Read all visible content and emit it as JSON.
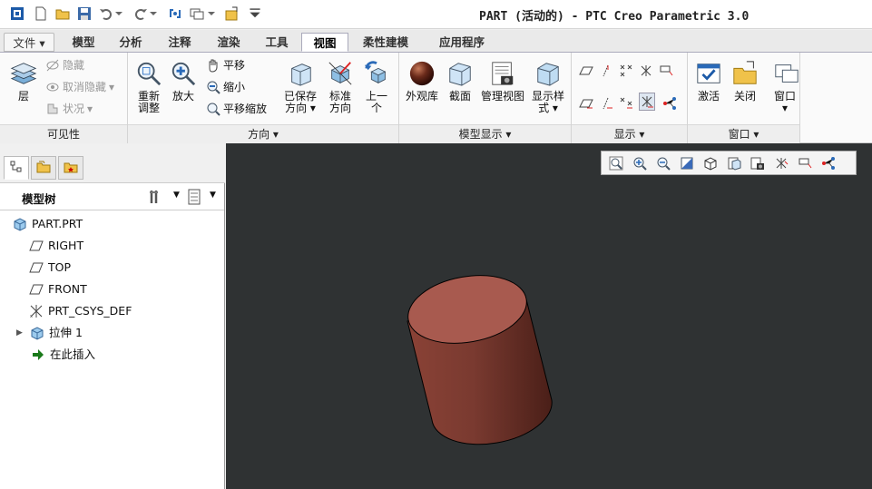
{
  "window": {
    "title": "PART (活动的) - PTC Creo Parametric 3.0"
  },
  "quick_access": [
    "app-icon",
    "new-icon",
    "open-icon",
    "save-icon",
    "undo-icon",
    "redo-icon",
    "regenerate-icon",
    "windows-icon",
    "close-window-icon",
    "customize-icon"
  ],
  "tabs": [
    {
      "label": "文件"
    },
    {
      "label": "模型"
    },
    {
      "label": "分析"
    },
    {
      "label": "注释"
    },
    {
      "label": "渲染"
    },
    {
      "label": "工具"
    },
    {
      "label": "视图"
    },
    {
      "label": "柔性建模"
    },
    {
      "label": "应用程序"
    }
  ],
  "active_tab": "视图",
  "ribbon": {
    "visibility": {
      "label": "可见性",
      "layer": "层",
      "hide": "隐藏",
      "unhide": "取消隐藏",
      "status": "状况"
    },
    "orientation": {
      "label": "方向",
      "refit_1": "重新",
      "refit_2": "调整",
      "zoom_in": "放大",
      "pan": "平移",
      "zoom_out": "缩小",
      "pan_zoom": "平移缩放",
      "saved_1": "已保存",
      "saved_2": "方向",
      "std_1": "标准",
      "std_2": "方向",
      "prev_1": "上一",
      "prev_2": "个"
    },
    "model_display": {
      "label": "模型显示",
      "appearance": "外观库",
      "section": "截面",
      "manage_views": "管理视图",
      "display_style_1": "显示样",
      "display_style_2": "式"
    },
    "show": {
      "label": "显示"
    },
    "window": {
      "label": "窗口",
      "activate": "激活",
      "close": "关闭",
      "window": "窗口"
    }
  },
  "model_tree": {
    "header": "模型树",
    "nodes": [
      {
        "label": "PART.PRT",
        "icon": "part-icon"
      },
      {
        "label": "RIGHT",
        "icon": "datum-plane-icon"
      },
      {
        "label": "TOP",
        "icon": "datum-plane-icon"
      },
      {
        "label": "FRONT",
        "icon": "datum-plane-icon"
      },
      {
        "label": "PRT_CSYS_DEF",
        "icon": "csys-icon"
      },
      {
        "label": "拉伸 1",
        "icon": "extrude-icon"
      },
      {
        "label": "在此插入",
        "icon": "insert-here-icon"
      }
    ]
  },
  "colors": {
    "canvas_bg": "#2f3233",
    "cylinder_top": "#a85a4f",
    "cylinder_side": "#7a3a30",
    "insert_arrow": "#1a7a1a"
  }
}
